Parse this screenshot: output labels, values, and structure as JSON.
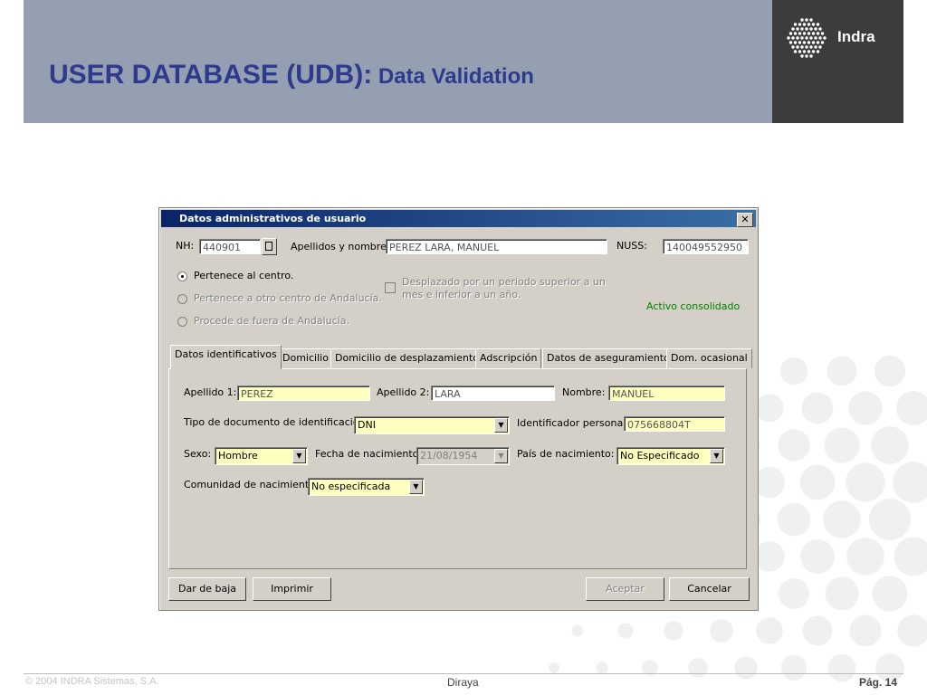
{
  "slide": {
    "title_main": "USER DATABASE (UDB):",
    "title_sub": " Data Validation",
    "brand": "Indra",
    "footer_left": "© 2004 INDRA Sistemas, S.A.",
    "footer_center": "Diraya",
    "footer_right": "Pág. 14"
  },
  "dialog": {
    "title": "Datos administrativos de usuario",
    "close_label": "✕",
    "nh_label": "NH:",
    "nh_value": "440901",
    "apellidos_label": "Apellidos y nombre:",
    "apellidos_value": "PEREZ LARA, MANUEL",
    "nuss_label": "NUSS:",
    "nuss_value": "140049552950",
    "radio1": "Pertenece al centro.",
    "radio2": "Pertenece a otro centro de Andalucía.",
    "radio3": "Procede de fuera de Andalucía.",
    "checkbox_line1": "Desplazado por un periodo superior a un",
    "checkbox_line2": "mes e inferior a un año.",
    "status": "Activo consolidado",
    "tabs": [
      {
        "label": "Datos identificativos"
      },
      {
        "label": "Domicilio"
      },
      {
        "label": "Domicilio de desplazamiento"
      },
      {
        "label": "Adscripción"
      },
      {
        "label": "Datos de aseguramiento"
      },
      {
        "label": "Dom. ocasional"
      }
    ],
    "form": {
      "apellido1_label": "Apellido 1:",
      "apellido1_value": "PEREZ",
      "apellido2_label": "Apellido 2:",
      "apellido2_value": "LARA",
      "nombre_label": "Nombre:",
      "nombre_value": "MANUEL",
      "tipo_doc_label": "Tipo de documento de identificación:",
      "tipo_doc_value": "DNI",
      "id_personal_label": "Identificador personal:",
      "id_personal_value": "075668804T",
      "sexo_label": "Sexo:",
      "sexo_value": "Hombre",
      "fecha_label": "Fecha de nacimiento:",
      "fecha_value": "21/08/1954",
      "pais_label": "País de nacimiento:",
      "pais_value": "No Especificado",
      "comunidad_label": "Comunidad de nacimiento:",
      "comunidad_value": "No especificada"
    },
    "buttons": {
      "baja": "Dar de baja",
      "imprimir": "Imprimir",
      "aceptar": "Aceptar",
      "cancelar": "Cancelar"
    }
  },
  "colors": {
    "header_bg": "#949fb1",
    "title_color": "#2e3a8c",
    "logo_bg": "#3c3c3c",
    "field_yellow": "#ffffc0",
    "status_green": "#008000",
    "titlebar_blue": "#0a246a"
  }
}
